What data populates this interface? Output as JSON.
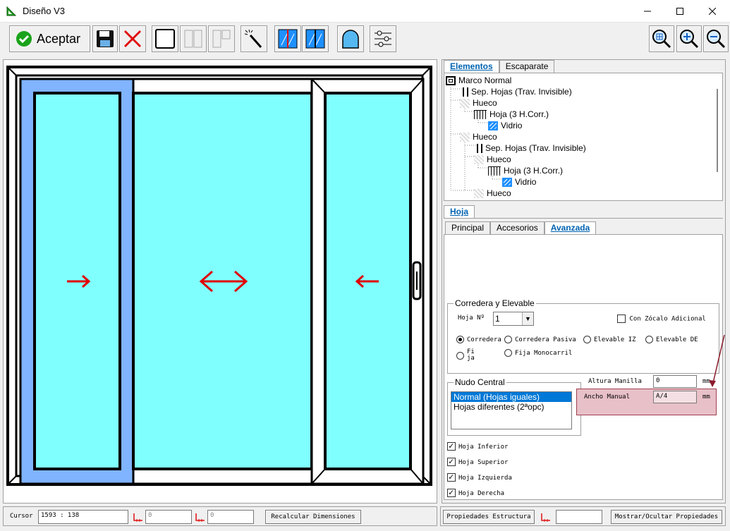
{
  "window": {
    "title": "Diseño V3"
  },
  "toolbar": {
    "accept_label": "Aceptar"
  },
  "tree_tabs": [
    "Elementos",
    "Escaparate"
  ],
  "tree": [
    {
      "label": "Marco Normal",
      "indent": 0,
      "icon": "frame-icon"
    },
    {
      "label": "Sep. Hojas (Trav. Invisible)",
      "indent": 1,
      "icon": "separator-icon"
    },
    {
      "label": "Hueco",
      "indent": 1,
      "icon": "gap-icon"
    },
    {
      "label": "Hoja (3 H.Corr.)",
      "indent": 2,
      "icon": "sash-icon"
    },
    {
      "label": "Vidrio",
      "indent": 3,
      "icon": "glass-icon"
    },
    {
      "label": "Hueco",
      "indent": 1,
      "icon": "gap-icon"
    },
    {
      "label": "Sep. Hojas (Trav. Invisible)",
      "indent": 2,
      "icon": "separator-icon"
    },
    {
      "label": "Hueco",
      "indent": 2,
      "icon": "gap-icon"
    },
    {
      "label": "Hoja (3 H.Corr.)",
      "indent": 3,
      "icon": "sash-icon"
    },
    {
      "label": "Vidrio",
      "indent": 4,
      "icon": "glass-icon"
    },
    {
      "label": "Hueco",
      "indent": 2,
      "icon": "gap-icon"
    }
  ],
  "section_tab": "Hoja",
  "prop_tabs": [
    "Principal",
    "Accesorios",
    "Avanzada"
  ],
  "corredera": {
    "title": "Corredera y Elevable",
    "hoja_label": "Hoja Nº",
    "hoja_value": "1",
    "zocalo_label": "Con Zócalo Adicional",
    "radios": [
      "Corredera",
      "Corredera Pasiva",
      "Elevable IZ",
      "Elevable DE",
      "Fija",
      "Fija Monocarril"
    ],
    "selected": "Corredera"
  },
  "nudo": {
    "title": "Nudo Central",
    "options": [
      "Normal (Hojas iguales)",
      "Hojas diferentes (2ªopc)"
    ],
    "selected": "Normal (Hojas iguales)"
  },
  "altura": {
    "label": "Altura Manilla",
    "value": "0",
    "unit": "mm"
  },
  "ancho": {
    "label": "Ancho Manual",
    "value": "A/4",
    "unit": "mm"
  },
  "checks": [
    {
      "label": "Hoja Inferior",
      "checked": true
    },
    {
      "label": "Hoja Superior",
      "checked": true
    },
    {
      "label": "Hoja Izquierda",
      "checked": true
    },
    {
      "label": "Hoja Derecha",
      "checked": true
    }
  ],
  "status": {
    "cursor_label": "Cursor",
    "cursor_value": "1593 : 138",
    "dim1": "0",
    "dim2": "0",
    "recalc_label": "Recalcular Dimensiones",
    "props_label": "Propiedades Estructura",
    "toggle_label": "Mostrar/Ocultar Propiedades"
  },
  "colors": {
    "glass": "#80ffff",
    "selected_sash": "#80b4ff",
    "arrow": "#e00000",
    "highlight": "#e8c0c8"
  }
}
